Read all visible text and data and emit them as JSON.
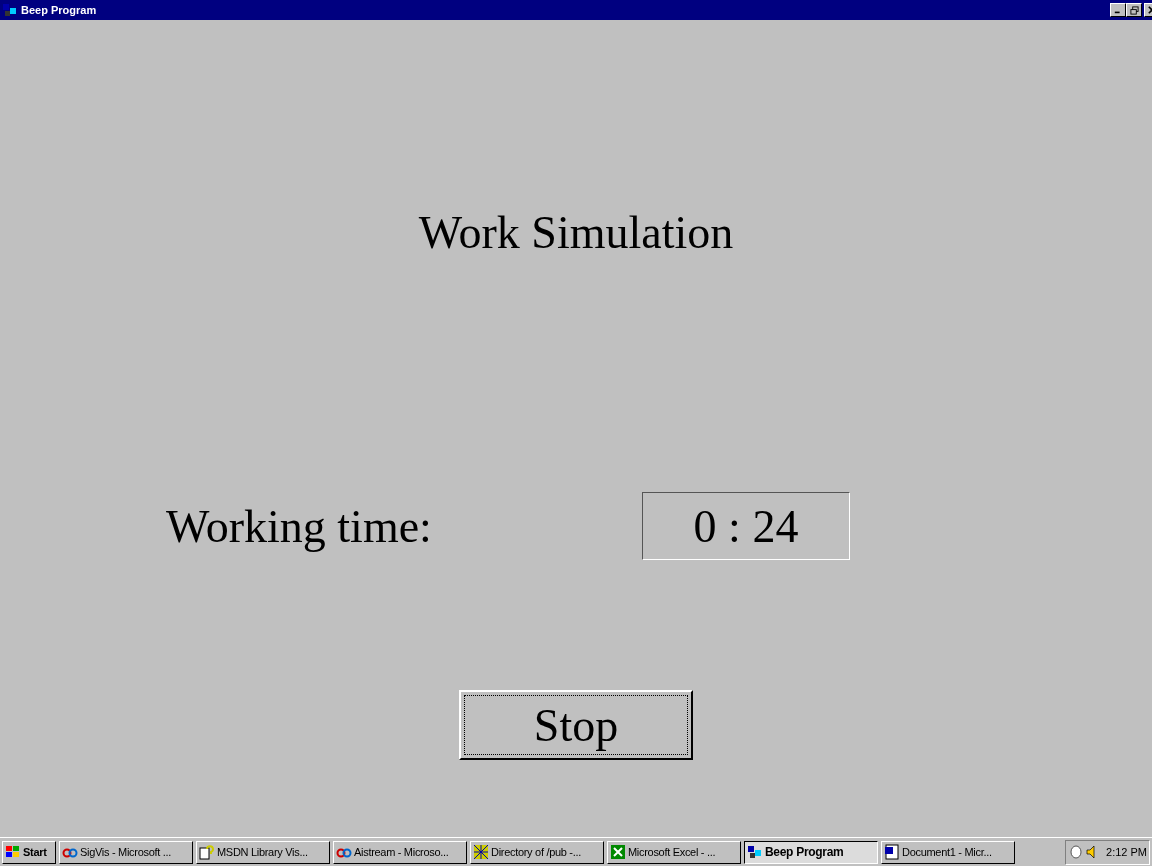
{
  "window": {
    "title": "Beep Program"
  },
  "heading": "Work Simulation",
  "timer": {
    "label": "Working time:",
    "value": "0 : 24"
  },
  "stop_button": "Stop",
  "taskbar": {
    "start": "Start",
    "tasks": [
      {
        "label": "SigVis - Microsoft ...",
        "selected": false
      },
      {
        "label": "MSDN Library Vis...",
        "selected": false
      },
      {
        "label": "Aistream - Microso...",
        "selected": false
      },
      {
        "label": "Directory of /pub -...",
        "selected": false
      },
      {
        "label": "Microsoft Excel - ...",
        "selected": false
      },
      {
        "label": "Beep Program",
        "selected": true
      },
      {
        "label": "Document1 - Micr...",
        "selected": false
      }
    ],
    "clock": "2:12 PM"
  }
}
